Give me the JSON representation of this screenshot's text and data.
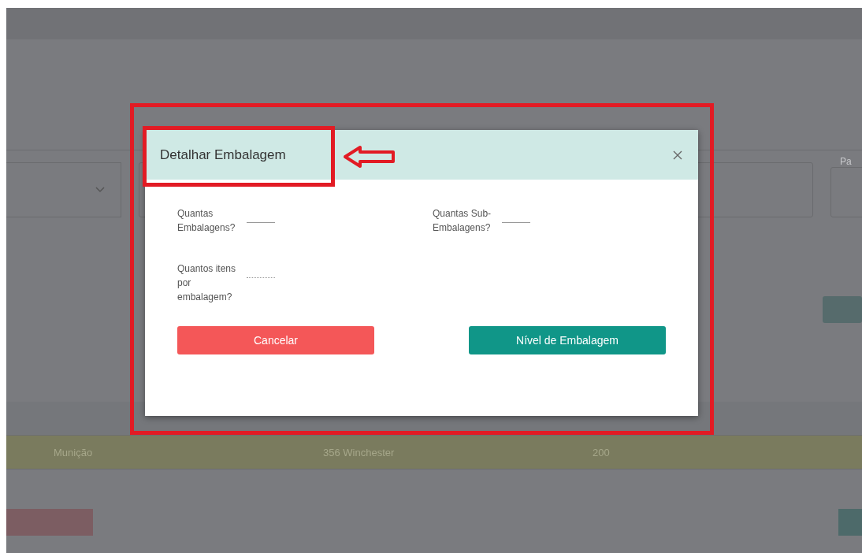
{
  "background": {
    "field_label": "Pa",
    "table": {
      "rows": [
        {
          "cells": [
            "Munição",
            "356 Winchester",
            "200"
          ],
          "selected": true
        }
      ]
    }
  },
  "dialog": {
    "title": "Detalhar Embalagem",
    "fields": [
      {
        "label": "Quantas Embalagens?",
        "disabled": false
      },
      {
        "label": "Quantas Sub-Embalagens?",
        "disabled": false
      },
      {
        "label": "Quantos itens por embalagem?",
        "disabled": true
      }
    ],
    "buttons": [
      {
        "label": "Cancelar",
        "kind": "cancel"
      },
      {
        "label": "Nível de Embalagem",
        "kind": "primary"
      }
    ]
  }
}
